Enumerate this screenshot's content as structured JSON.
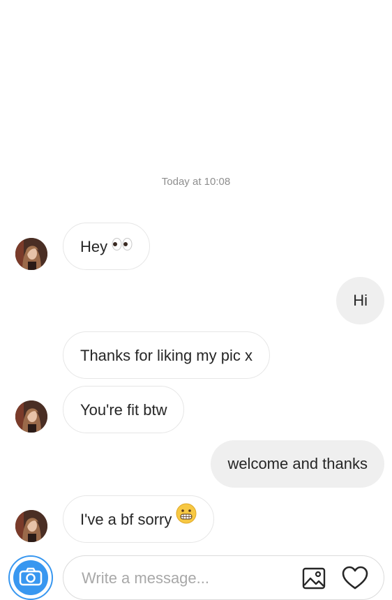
{
  "thread": {
    "timestamp": "Today at 10:08"
  },
  "messages": [
    {
      "sender": "them",
      "text": "Hey",
      "emoji": "eyes-emoji"
    },
    {
      "sender": "me",
      "text": "Hi"
    },
    {
      "sender": "them",
      "text": "Thanks for liking my pic x"
    },
    {
      "sender": "them",
      "text": "You're fit btw"
    },
    {
      "sender": "me",
      "text": "welcome and thanks"
    },
    {
      "sender": "them",
      "text": "I've a bf sorry",
      "emoji": "grimacing-face-emoji"
    }
  ],
  "composer": {
    "placeholder": "Write a message...",
    "value": "",
    "camera_icon": "camera-icon",
    "gallery_icon": "image-gallery-icon",
    "like_icon": "heart-icon"
  },
  "colors": {
    "accent": "#3897f0",
    "incoming_border": "#e6e6e6",
    "outgoing_bg": "#efefef",
    "timestamp": "#8e8e8e",
    "placeholder": "#a8a8a8"
  }
}
